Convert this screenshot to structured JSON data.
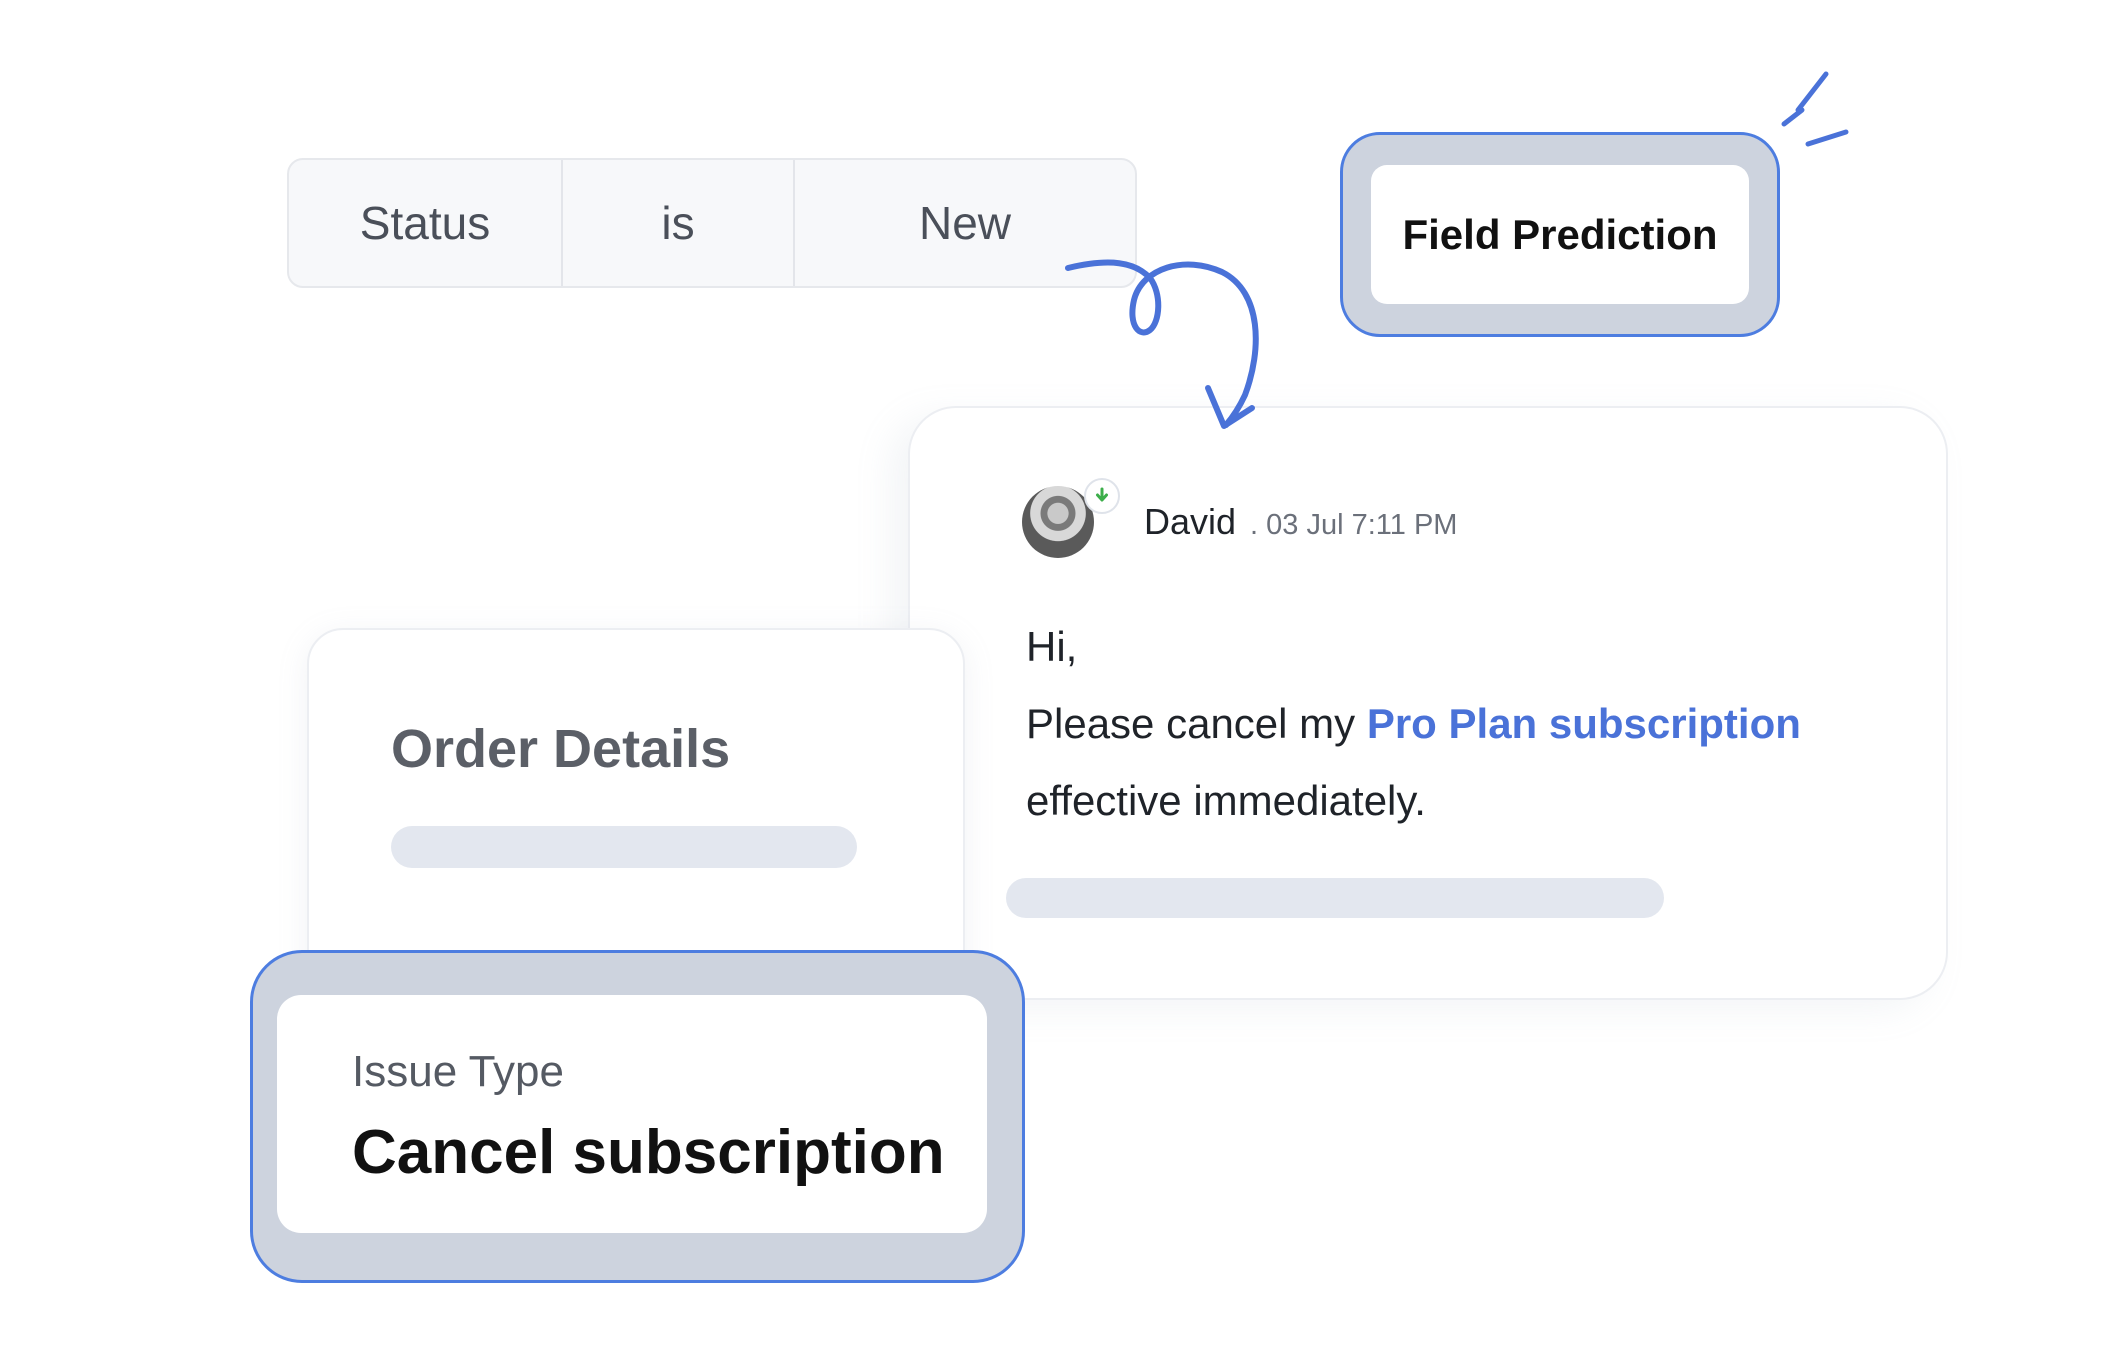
{
  "filter": {
    "field": "Status",
    "operator": "is",
    "value": "New"
  },
  "badge": {
    "label": "Field Prediction"
  },
  "message": {
    "sender": "David",
    "timestamp": ". 03 Jul 7:11 PM",
    "greeting": "Hi,",
    "line1_prefix": "Please cancel my ",
    "line1_highlight": "Pro Plan subscription",
    "line2": "effective immediately."
  },
  "order": {
    "title": "Order Details"
  },
  "issue": {
    "label": "Issue Type",
    "value": "Cancel subscription"
  },
  "icons": {
    "avatar": "user-avatar",
    "status": "green-arrow-icon",
    "connector": "curly-arrow-icon",
    "sparkle": "sparkle-lines-icon"
  },
  "colors": {
    "accent": "#4d7de0",
    "highlight": "#4a72d8",
    "badge_fill": "#cdd3de",
    "placeholder": "#e3e7ef"
  }
}
